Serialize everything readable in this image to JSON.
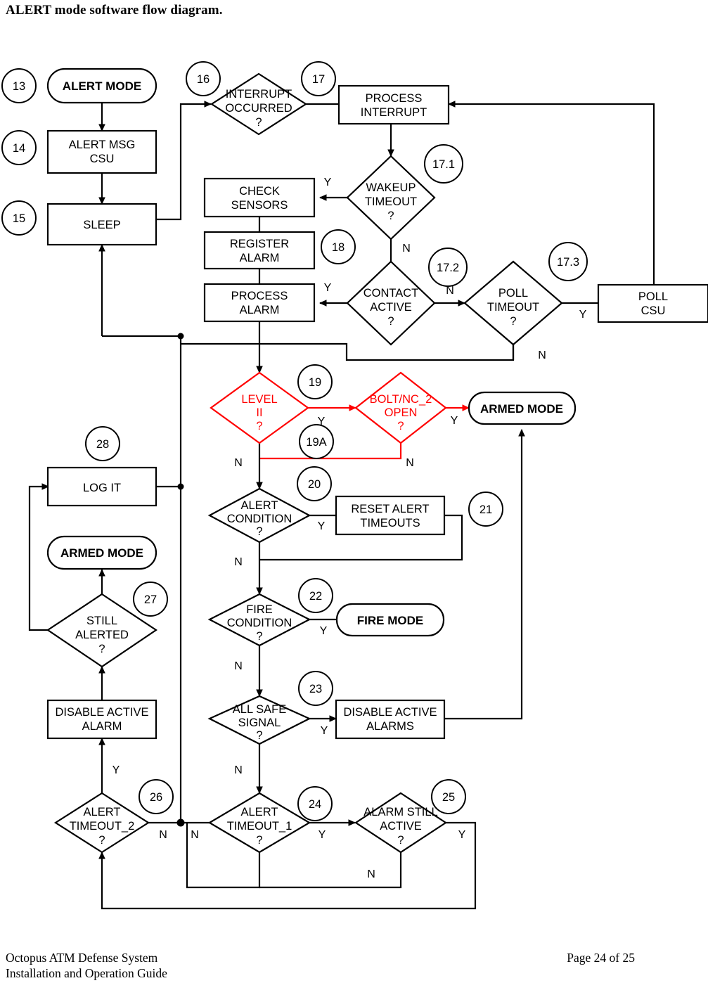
{
  "page_title": "ALERT mode software flow diagram.",
  "footer": {
    "line1": "Octopus ATM Defense System",
    "line2": "Installation and Operation Guide",
    "page": "Page 24 of 25"
  },
  "colors": {
    "line": "#000000",
    "highlight": "#ff0000",
    "background": "#ffffff"
  },
  "nodes": {
    "alert_mode": "ALERT MODE",
    "alert_msg_csu": "ALERT MSG\nCSU",
    "alert_msg_csu_l1": "ALERT MSG",
    "alert_msg_csu_l2": "CSU",
    "sleep": "SLEEP",
    "interrupt_occurred_l1": "INTERRUPT",
    "interrupt_occurred_l2": "OCCURRED",
    "interrupt_occurred_l3": "?",
    "process_interrupt_l1": "PROCESS",
    "process_interrupt_l2": "INTERRUPT",
    "wakeup_timeout_l1": "WAKEUP",
    "wakeup_timeout_l2": "TIMEOUT",
    "wakeup_timeout_l3": "?",
    "check_sensors_l1": "CHECK",
    "check_sensors_l2": "SENSORS",
    "register_alarm_l1": "REGISTER",
    "register_alarm_l2": "ALARM",
    "process_alarm_l1": "PROCESS",
    "process_alarm_l2": "ALARM",
    "contact_active_l1": "CONTACT",
    "contact_active_l2": "ACTIVE",
    "contact_active_l3": "?",
    "poll_timeout_l1": "POLL",
    "poll_timeout_l2": "TIMEOUT",
    "poll_timeout_l3": "?",
    "poll_csu_l1": "POLL",
    "poll_csu_l2": "CSU",
    "level_ii_l1": "LEVEL",
    "level_ii_l2": "II",
    "level_ii_l3": "?",
    "bolt_nc2_open_l1": "BOLT/NC_2",
    "bolt_nc2_open_l2": "OPEN",
    "bolt_nc2_open_l3": "?",
    "armed_mode_top": "ARMED  MODE",
    "alert_condition_l1": "ALERT",
    "alert_condition_l2": "CONDITION",
    "alert_condition_l3": "?",
    "reset_alert_timeouts_l1": "RESET ALERT",
    "reset_alert_timeouts_l2": "TIMEOUTS",
    "fire_condition_l1": "FIRE",
    "fire_condition_l2": "CONDITION",
    "fire_condition_l3": "?",
    "fire_mode": "FIRE MODE",
    "all_safe_signal_l1": "ALL SAFE",
    "all_safe_signal_l2": "SIGNAL",
    "all_safe_signal_l3": "?",
    "disable_active_alarms_l1": "DISABLE ACTIVE",
    "disable_active_alarms_l2": "ALARMS",
    "alert_timeout_1_l1": "ALERT",
    "alert_timeout_1_l2": "TIMEOUT_1",
    "alert_timeout_1_l3": "?",
    "alarm_still_active_l1": "ALARM STILL",
    "alarm_still_active_l2": "ACTIVE",
    "alarm_still_active_l3": "?",
    "alert_timeout_2_l1": "ALERT",
    "alert_timeout_2_l2": "TIMEOUT_2",
    "alert_timeout_2_l3": "?",
    "disable_active_alarm_l1": "DISABLE ACTIVE",
    "disable_active_alarm_l2": "ALARM",
    "still_alerted_l1": "STILL",
    "still_alerted_l2": "ALERTED",
    "still_alerted_l3": "?",
    "armed_mode_left": "ARMED  MODE",
    "log_it": "LOG IT"
  },
  "step_tags": {
    "t13": "13",
    "t14": "14",
    "t15": "15",
    "t16": "16",
    "t17": "17",
    "t171": "17.1",
    "t172": "17.2",
    "t173": "17.3",
    "t18": "18",
    "t19": "19",
    "t19a": "19A",
    "t20": "20",
    "t21": "21",
    "t22": "22",
    "t23": "23",
    "t24": "24",
    "t25": "25",
    "t26": "26",
    "t27": "27",
    "t28": "28"
  },
  "branch_labels": {
    "wakeup_y": "Y",
    "wakeup_n": "N",
    "contact_y": "Y",
    "contact_n": "N",
    "poll_y": "Y",
    "poll_n": "N",
    "level_y": "Y",
    "level_n": "N",
    "bolt_y": "Y",
    "bolt_n": "N",
    "alertcond_y": "Y",
    "alertcond_n": "N",
    "fire_y": "Y",
    "fire_n": "N",
    "allsafe_y": "Y",
    "allsafe_n": "N",
    "at1_y": "Y",
    "at1_n": "N",
    "alarmstill_y": "Y",
    "alarmstill_n": "N",
    "at2_y": "Y",
    "at2_n": "N"
  }
}
